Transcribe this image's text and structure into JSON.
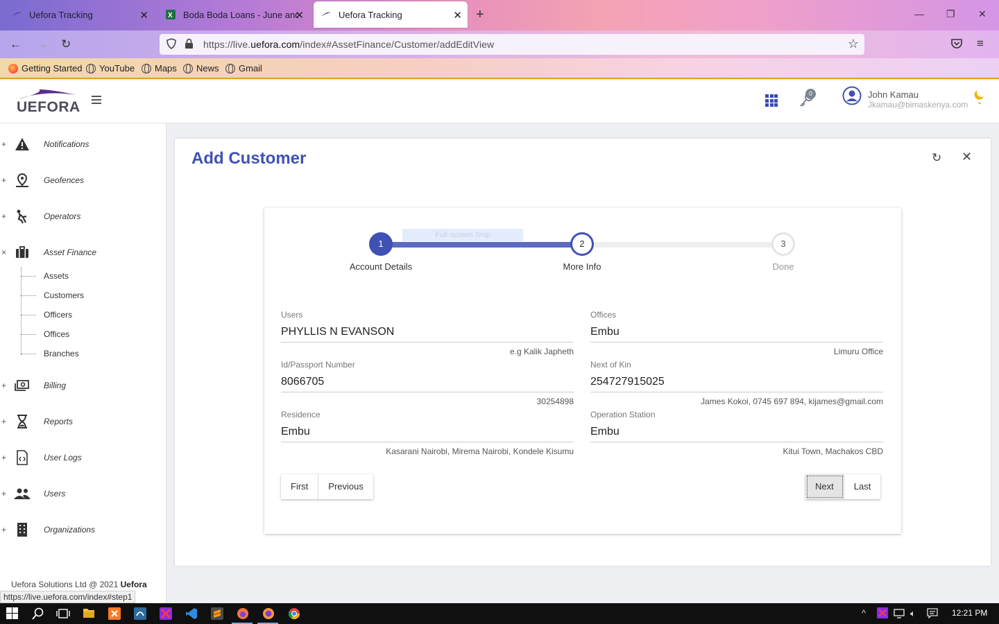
{
  "browser": {
    "tabs": [
      {
        "title": "Uefora Tracking"
      },
      {
        "title": "Boda Boda Loans - June and Jul"
      },
      {
        "title": "Uefora Tracking"
      }
    ],
    "url_prefix": "https://live.",
    "url_domain": "uefora.com",
    "url_path": "/index#AssetFinance/Customer/addEditView",
    "bookmarks": [
      "Getting Started",
      "YouTube",
      "Maps",
      "News",
      "Gmail"
    ],
    "status_url": "https://live.uefora.com/index#step1"
  },
  "app": {
    "logo_text": "UEFORA",
    "notification_count": "0",
    "user": {
      "name": "John Kamau",
      "email": "Jkamau@bimaskenya.com"
    }
  },
  "sidebar": {
    "items": [
      {
        "label": "Notifications",
        "toggle": "+"
      },
      {
        "label": "Geofences",
        "toggle": "+"
      },
      {
        "label": "Operators",
        "toggle": "+"
      },
      {
        "label": "Asset Finance",
        "toggle": "×"
      },
      {
        "label": "Billing",
        "toggle": "+"
      },
      {
        "label": "Reports",
        "toggle": "+"
      },
      {
        "label": "User Logs",
        "toggle": "+"
      },
      {
        "label": "Users",
        "toggle": "+"
      },
      {
        "label": "Organizations",
        "toggle": "+"
      }
    ],
    "sub_items": [
      "Assets",
      "Customers",
      "Officers",
      "Offices",
      "Branches"
    ],
    "footer_prefix": "Uefora Solutions Ltd @ 2021 ",
    "footer_brand": "Uefora"
  },
  "page": {
    "title": "Add Customer",
    "snip_overlay": "Full-screen Snip",
    "wizard": {
      "steps": [
        {
          "number": "1",
          "label": "Account Details",
          "state": "done"
        },
        {
          "number": "2",
          "label": "More Info",
          "state": "current"
        },
        {
          "number": "3",
          "label": "Done",
          "state": "todo"
        }
      ],
      "progress_fraction": 0.5
    },
    "fields": {
      "users": {
        "label": "Users",
        "value": "PHYLLIS N EVANSON",
        "hint": "e.g Kalik Japheth"
      },
      "offices": {
        "label": "Offices",
        "value": "Embu",
        "hint": "Limuru Office"
      },
      "id_passport": {
        "label": "Id/Passport Number",
        "value": "8066705",
        "hint": "30254898"
      },
      "next_of_kin": {
        "label": "Next of Kin",
        "value": "254727915025",
        "hint": "James Kokoi, 0745 697 894, kijames@gmail.com"
      },
      "residence": {
        "label": "Residence",
        "value": "Embu",
        "hint": "Kasarani Nairobi, Mirema Nairobi, Kondele Kisumu"
      },
      "operation_station": {
        "label": "Operation Station",
        "value": "Embu",
        "hint": "Kitui Town, Machakos CBD"
      }
    },
    "buttons": {
      "first": "First",
      "previous": "Previous",
      "next": "Next",
      "last": "Last"
    }
  },
  "taskbar": {
    "clock": "12:21 PM"
  },
  "colors": {
    "accent": "#3f51b5",
    "track_fill": "#5c6bc0",
    "moon": "#f2b400"
  }
}
